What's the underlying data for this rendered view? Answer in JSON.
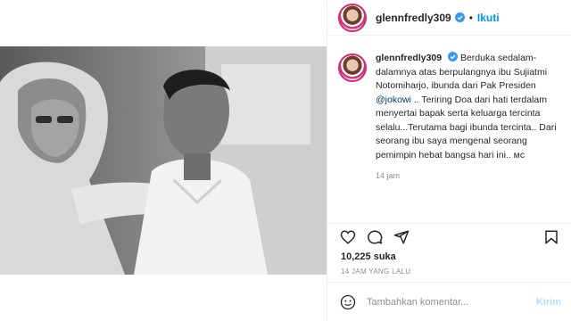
{
  "post": {
    "username": "glennfredly309",
    "follow_label": "Ikuti",
    "dot": "•",
    "caption_pre": "Berduka sedalam-dalamnya atas berpulangnya ibu Sujiatmi Notomiharjo, ibunda dari Pak Presiden ",
    "caption_mention": "@jokowi",
    "caption_post": " .. Teriring Doa dari hati terdalam menyertai bapak serta keluarga tercinta selalu...Terutama bagi ibunda tercinta.. Dari seorang ibu saya mengenal seorang pemimpin hebat bangsa hari ini.. мс",
    "caption_time": "14 jam",
    "likes": "10,225 suka",
    "posted_ago": "14 JAM YANG LALU",
    "comment_placeholder": "Tambahkan komentar...",
    "send_label": "Kirim"
  },
  "icons": {
    "verified": "verified-badge-icon",
    "like": "heart-icon",
    "comment": "comment-icon",
    "share": "share-icon",
    "save": "bookmark-icon",
    "emoji": "emoji-icon"
  },
  "colors": {
    "accent": "#0095f6",
    "verified": "#3897f0",
    "muted": "#8e8e8e",
    "send_disabled": "#b2dffc"
  }
}
